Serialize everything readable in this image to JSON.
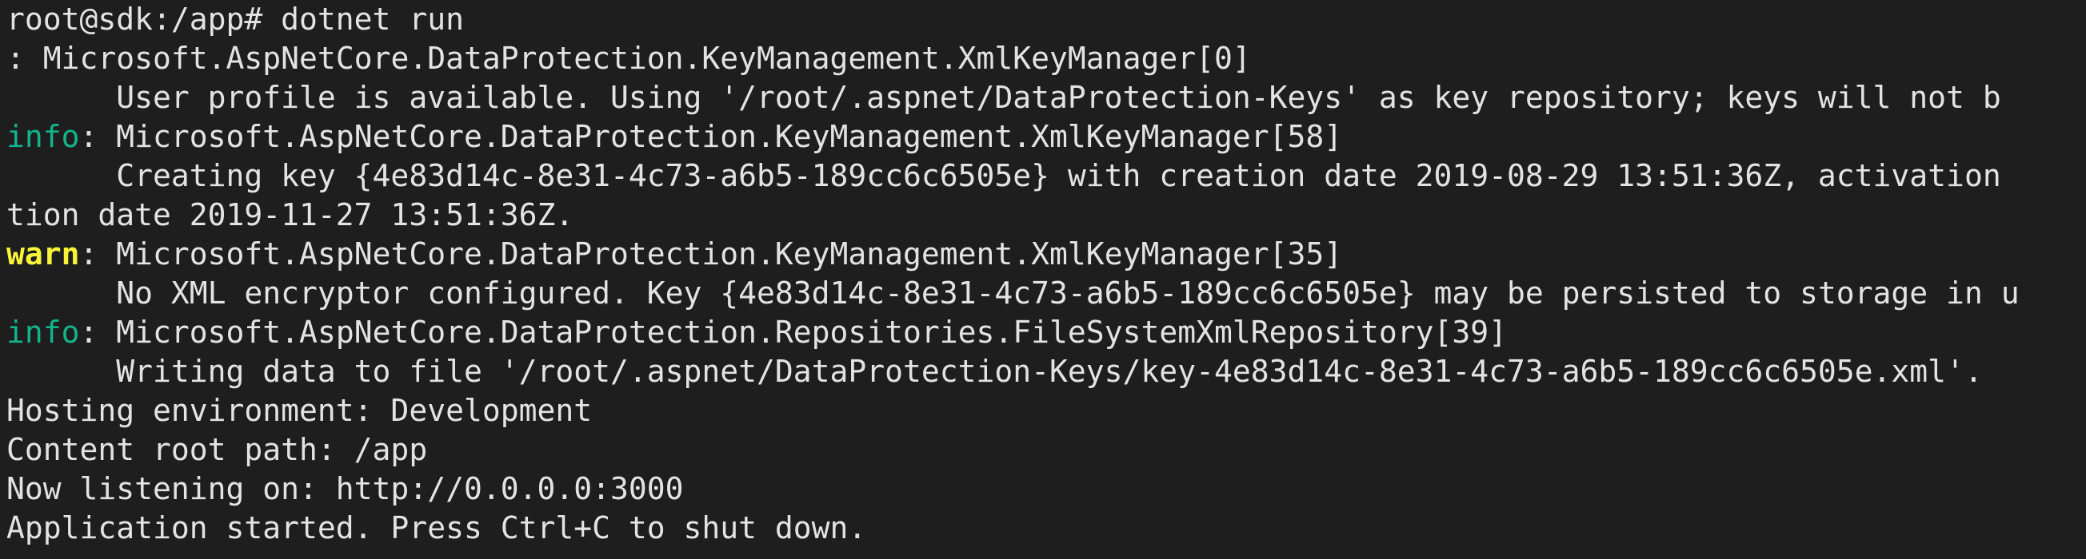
{
  "terminal": {
    "prompt": "root@sdk:/app# ",
    "command": "dotnet run",
    "log": [
      {
        "level": "",
        "sep": ": ",
        "source": "Microsoft.AspNetCore.DataProtection.KeyManagement.XmlKeyManager[0]"
      },
      {
        "message": "      User profile is available. Using '/root/.aspnet/DataProtection-Keys' as key repository; keys will not b"
      },
      {
        "level": "info",
        "sep": ": ",
        "source": "Microsoft.AspNetCore.DataProtection.KeyManagement.XmlKeyManager[58]"
      },
      {
        "message": "      Creating key {4e83d14c-8e31-4c73-a6b5-189cc6c6505e} with creation date 2019-08-29 13:51:36Z, activation"
      },
      {
        "message": "tion date 2019-11-27 13:51:36Z."
      },
      {
        "level": "warn",
        "sep": ": ",
        "source": "Microsoft.AspNetCore.DataProtection.KeyManagement.XmlKeyManager[35]"
      },
      {
        "message": "      No XML encryptor configured. Key {4e83d14c-8e31-4c73-a6b5-189cc6c6505e} may be persisted to storage in u"
      },
      {
        "level": "info",
        "sep": ": ",
        "source": "Microsoft.AspNetCore.DataProtection.Repositories.FileSystemXmlRepository[39]"
      },
      {
        "message": "      Writing data to file '/root/.aspnet/DataProtection-Keys/key-4e83d14c-8e31-4c73-a6b5-189cc6c6505e.xml'."
      }
    ],
    "status": [
      "Hosting environment: Development",
      "Content root path: /app",
      "Now listening on: http://0.0.0.0:3000",
      "Application started. Press Ctrl+C to shut down."
    ]
  },
  "colors": {
    "background": "#1e1e1e",
    "text": "#e3e3e3",
    "info": "#13b38c",
    "warn": "#f7f339"
  }
}
